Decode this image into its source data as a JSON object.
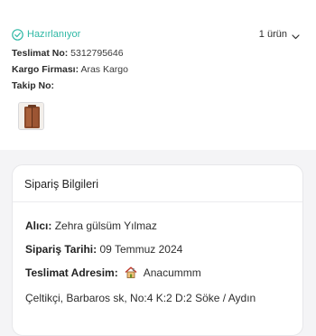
{
  "shipment": {
    "status": "Hazırlanıyor",
    "status_color": "#2eb8a5",
    "status_icon": "check-circle-icon",
    "item_count": "1 ürün",
    "tracking_label": "Teslimat No:",
    "tracking_value": "5312795646",
    "carrier_label": "Kargo Firması:",
    "carrier_value": "Aras Kargo",
    "track_no_label": "Takip No:",
    "track_no_value": "",
    "product_thumbnail": "product-thumbnail"
  },
  "order_info": {
    "title": "Sipariş Bilgileri",
    "recipient_label": "Alıcı:",
    "recipient_value": "Zehra gülsüm Yılmaz",
    "date_label": "Sipariş Tarihi:",
    "date_value": "09 Temmuz 2024",
    "address_label": "Teslimat Adresim:",
    "address_icon": "house-icon",
    "address_name": "Anacummm",
    "address_full": "Çeltikçi, Barbaros sk, No:4 K:2 D:2 Söke / Aydın"
  }
}
